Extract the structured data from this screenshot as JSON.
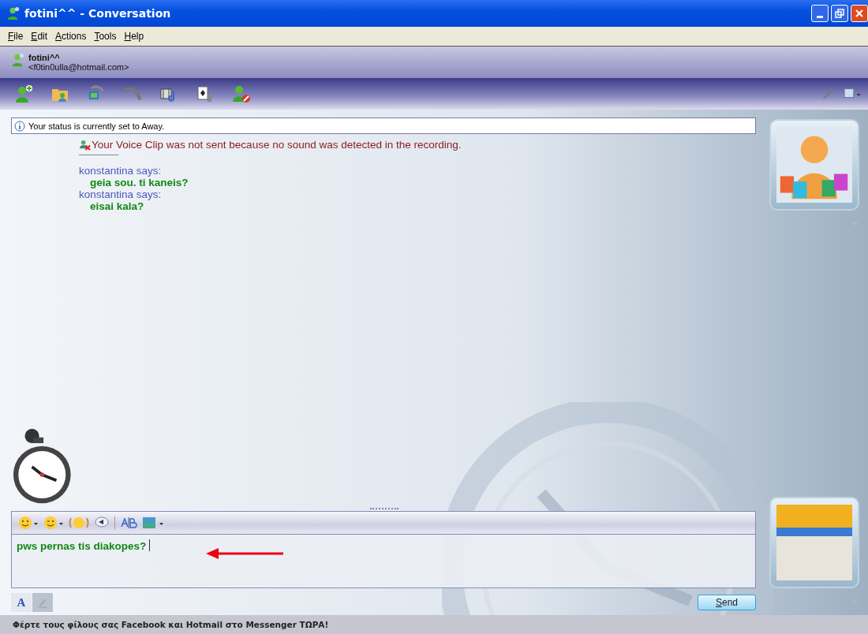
{
  "window": {
    "title": "fotini^^ - Conversation"
  },
  "menu": [
    {
      "label": "File"
    },
    {
      "label": "Edit"
    },
    {
      "label": "Actions"
    },
    {
      "label": "Tools"
    },
    {
      "label": "Help"
    }
  ],
  "contact": {
    "name": "fotini^^",
    "email": "<f0tin0ulla@hotmail.com>"
  },
  "status_notice": "Your status is currently set to Away.",
  "messages": [
    {
      "kind": "error",
      "text": "Your Voice Clip was not sent because no sound was detected in the recording."
    },
    {
      "kind": "chat",
      "sender": "konstantina says:",
      "text": "geia sou. ti kaneis?"
    },
    {
      "kind": "chat",
      "sender": "konstantina says:",
      "text": "eisai kala?"
    }
  ],
  "input": {
    "value": "pws pernas tis diakopes?"
  },
  "format_tabs": [
    {
      "kind": "text",
      "label": "A",
      "selected": true
    },
    {
      "kind": "handwriting",
      "selected": false
    }
  ],
  "send_button": "Send",
  "ad_text": "Φέρτε τους φίλους σας Facebook και Hotmail στο Messenger ΤΩΡΑ!"
}
